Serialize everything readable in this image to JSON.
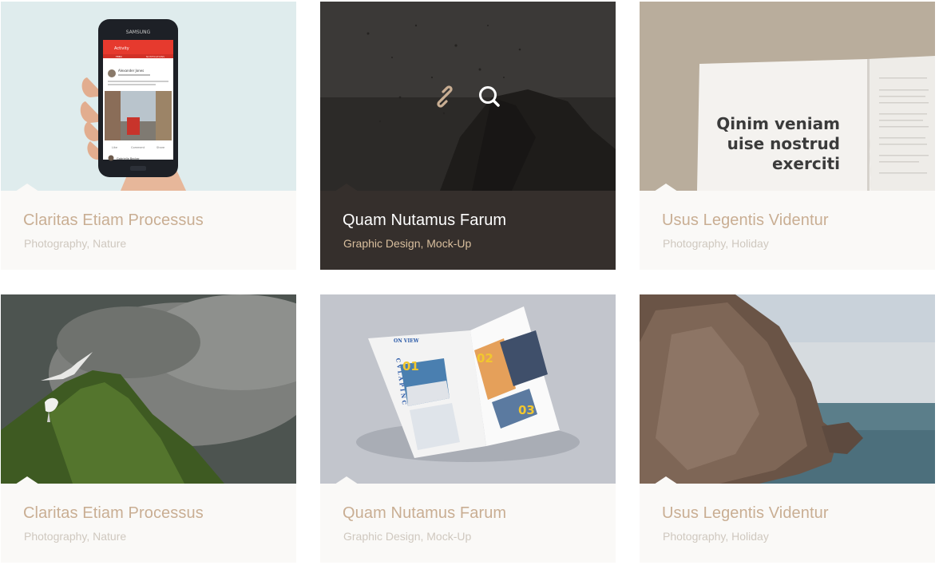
{
  "portfolio": {
    "items": [
      {
        "title": "Claritas Etiam Processus",
        "categories": "Photography, Nature",
        "image": "phone-in-hand-app",
        "phone_brand": "SAMSUNG",
        "app_title": "Activity",
        "user_name": "Alexander Jones",
        "user2_name": "Gabriella Becker",
        "tab1": "FEED",
        "tab2": "NOTIFICATIONS",
        "action1": "Like",
        "action2": "Comment",
        "action3": "Share"
      },
      {
        "title": "Quam Nutamus Farum",
        "categories": "Graphic Design, Mock-Up",
        "image": "dark-rock-splash",
        "hovered": true
      },
      {
        "title": "Usus Legentis Videntur",
        "categories": "Photography, Holiday",
        "image": "open-notebook",
        "notebook_text": [
          "Qinim veniam",
          "uise nostrud",
          "exerciti"
        ]
      },
      {
        "title": "Claritas Etiam Processus",
        "categories": "Photography, Nature",
        "image": "seagulls-on-mossy-hill"
      },
      {
        "title": "Quam Nutamus Farum",
        "categories": "Graphic Design, Mock-Up",
        "image": "magazine-mockup",
        "mag_heading": "ON VIEW",
        "mag_vertical": "C V L A P I N C",
        "mag_numbers": [
          "01",
          "02",
          "03"
        ]
      },
      {
        "title": "Usus Legentis Videntur",
        "categories": "Photography, Holiday",
        "image": "sea-cliff"
      }
    ]
  },
  "overlay_icons": {
    "link": "link-icon",
    "zoom": "search-icon"
  },
  "colors": {
    "card_bg": "#faf9f7",
    "title": "#c9ae93",
    "category": "#cfc8bf",
    "active_bg": "#352f2c",
    "active_title": "#ffffff",
    "active_category": "#d9bf9e",
    "link_icon": "#c9ae93"
  }
}
